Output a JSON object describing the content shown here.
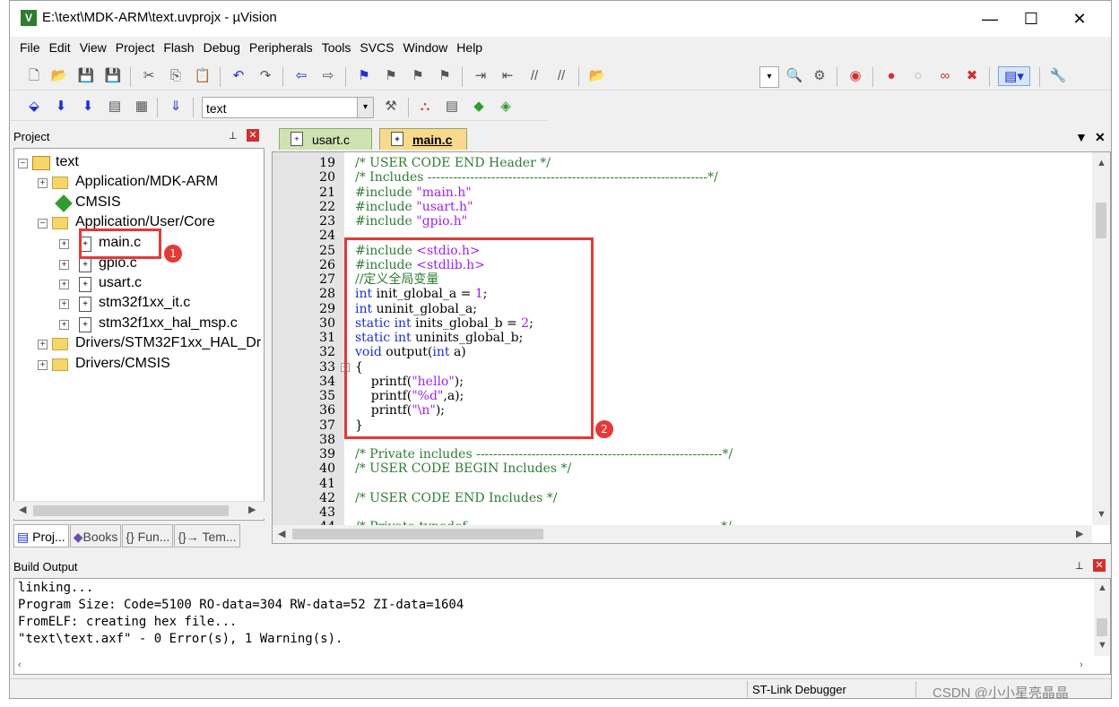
{
  "window": {
    "title": "E:\\text\\MDK-ARM\\text.uvprojx - µVision",
    "app_icon": "V",
    "controls": {
      "minimize": "—",
      "maximize": "☐",
      "close": "✕"
    }
  },
  "menu": [
    "File",
    "Edit",
    "View",
    "Project",
    "Flash",
    "Debug",
    "Peripherals",
    "Tools",
    "SVCS",
    "Window",
    "Help"
  ],
  "toolbar": {
    "target_name": "text"
  },
  "project_panel": {
    "title": "Project",
    "pin": "📌",
    "close": "✕",
    "tree": [
      {
        "label": "text",
        "level": 0,
        "expand": "−",
        "kind": "root"
      },
      {
        "label": "Application/MDK-ARM",
        "level": 1,
        "expand": "+",
        "kind": "folder"
      },
      {
        "label": "CMSIS",
        "level": 1,
        "expand": "",
        "kind": "gem"
      },
      {
        "label": "Application/User/Core",
        "level": 1,
        "expand": "−",
        "kind": "folder"
      },
      {
        "label": "main.c",
        "level": 2,
        "expand": "+",
        "kind": "file"
      },
      {
        "label": "gpio.c",
        "level": 2,
        "expand": "+",
        "kind": "file"
      },
      {
        "label": "usart.c",
        "level": 2,
        "expand": "+",
        "kind": "file"
      },
      {
        "label": "stm32f1xx_it.c",
        "level": 2,
        "expand": "+",
        "kind": "file"
      },
      {
        "label": "stm32f1xx_hal_msp.c",
        "level": 2,
        "expand": "+",
        "kind": "file"
      },
      {
        "label": "Drivers/STM32F1xx_HAL_Dr",
        "level": 1,
        "expand": "+",
        "kind": "folder"
      },
      {
        "label": "Drivers/CMSIS",
        "level": 1,
        "expand": "+",
        "kind": "folder"
      }
    ],
    "tabs": [
      "Proj...",
      "Books",
      "{} Fun...",
      "{}→ Tem..."
    ]
  },
  "editor": {
    "tabs": [
      "usart.c",
      "main.c"
    ],
    "active_tab": "main.c",
    "lines": [
      {
        "n": "19",
        "parts": [
          [
            "cm",
            "/* USER CODE END Header */"
          ]
        ]
      },
      {
        "n": "20",
        "parts": [
          [
            "cm",
            "/* Includes ------------------------------------------------------------------*/"
          ]
        ]
      },
      {
        "n": "21",
        "parts": [
          [
            "pp",
            "#include "
          ],
          [
            "str",
            "\"main.h\""
          ]
        ]
      },
      {
        "n": "22",
        "parts": [
          [
            "pp",
            "#include "
          ],
          [
            "str",
            "\"usart.h\""
          ]
        ]
      },
      {
        "n": "23",
        "parts": [
          [
            "pp",
            "#include "
          ],
          [
            "str",
            "\"gpio.h\""
          ]
        ]
      },
      {
        "n": "24",
        "parts": []
      },
      {
        "n": "25",
        "parts": [
          [
            "pp",
            "#include "
          ],
          [
            "str",
            "<stdio.h>"
          ]
        ]
      },
      {
        "n": "26",
        "parts": [
          [
            "pp",
            "#include "
          ],
          [
            "str",
            "<stdlib.h>"
          ]
        ]
      },
      {
        "n": "27",
        "parts": [
          [
            "cm",
            "//定义全局变量"
          ]
        ]
      },
      {
        "n": "28",
        "parts": [
          [
            "kw",
            "int"
          ],
          [
            "plain",
            " init_global_a = "
          ],
          [
            "num",
            "1"
          ],
          [
            "plain",
            ";"
          ]
        ]
      },
      {
        "n": "29",
        "parts": [
          [
            "kw",
            "int"
          ],
          [
            "plain",
            " uninit_global_a;"
          ]
        ]
      },
      {
        "n": "30",
        "parts": [
          [
            "kw",
            "static"
          ],
          [
            "plain",
            " "
          ],
          [
            "kw",
            "int"
          ],
          [
            "plain",
            " inits_global_b = "
          ],
          [
            "num",
            "2"
          ],
          [
            "plain",
            ";"
          ]
        ]
      },
      {
        "n": "31",
        "parts": [
          [
            "kw",
            "static"
          ],
          [
            "plain",
            " "
          ],
          [
            "kw",
            "int"
          ],
          [
            "plain",
            " uninits_global_b;"
          ]
        ]
      },
      {
        "n": "32",
        "parts": [
          [
            "kw",
            "void"
          ],
          [
            "plain",
            " output("
          ],
          [
            "kw",
            "int"
          ],
          [
            "plain",
            " a)"
          ]
        ]
      },
      {
        "n": "33",
        "parts": [
          [
            "plain",
            "{"
          ]
        ],
        "fold": "−"
      },
      {
        "n": "34",
        "parts": [
          [
            "plain",
            "    printf("
          ],
          [
            "str",
            "\"hello\""
          ],
          [
            "plain",
            ");"
          ]
        ]
      },
      {
        "n": "35",
        "parts": [
          [
            "plain",
            "    printf("
          ],
          [
            "str",
            "\"%d\""
          ],
          [
            "plain",
            ",a);"
          ]
        ]
      },
      {
        "n": "36",
        "parts": [
          [
            "plain",
            "    printf("
          ],
          [
            "str",
            "\"\\n\""
          ],
          [
            "plain",
            ");"
          ]
        ]
      },
      {
        "n": "37",
        "parts": [
          [
            "plain",
            "}"
          ]
        ]
      },
      {
        "n": "38",
        "parts": []
      },
      {
        "n": "39",
        "parts": [
          [
            "cm",
            "/* Private includes ----------------------------------------------------------*/"
          ]
        ]
      },
      {
        "n": "40",
        "parts": [
          [
            "cm",
            "/* USER CODE BEGIN Includes */"
          ]
        ]
      },
      {
        "n": "41",
        "parts": []
      },
      {
        "n": "42",
        "parts": [
          [
            "cm",
            "/* USER CODE END Includes */"
          ]
        ]
      },
      {
        "n": "43",
        "parts": []
      },
      {
        "n": "44",
        "parts": [
          [
            "cm",
            "/* Private typedef -----------------------------------------------------------*/"
          ]
        ]
      }
    ]
  },
  "annotations": {
    "marker_1": "1",
    "marker_2": "2"
  },
  "build_output": {
    "title": "Build Output",
    "lines": [
      "linking...",
      "Program Size: Code=5100 RO-data=304 RW-data=52 ZI-data=1604",
      "FromELF: creating hex file...",
      "\"text\\text.axf\" - 0 Error(s), 1 Warning(s)."
    ]
  },
  "status_bar": {
    "debugger": "ST-Link Debugger"
  },
  "watermark": "CSDN @小小星亮晶晶"
}
